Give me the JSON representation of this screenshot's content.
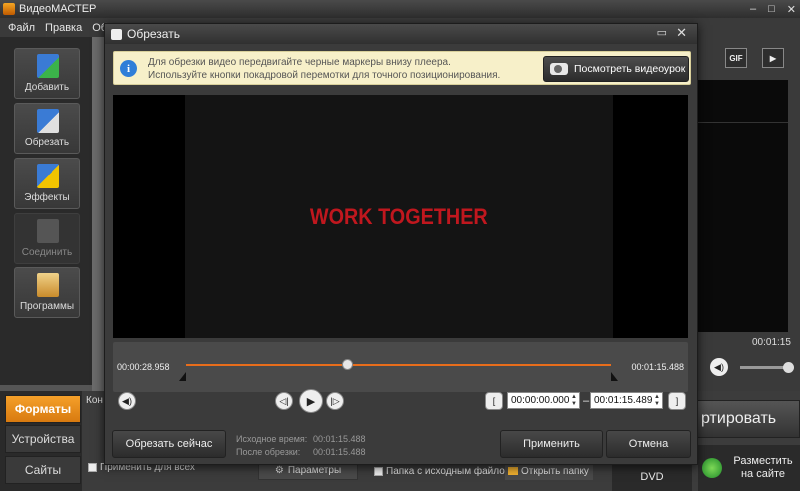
{
  "app": {
    "title": "ВидеоМАСТЕР",
    "window_buttons": [
      "–",
      "□",
      "✕"
    ]
  },
  "menu": [
    "Файл",
    "Правка",
    "Обр"
  ],
  "toolbar": [
    {
      "name": "add",
      "label": "Добавить",
      "icon": "film-plus-icon",
      "color": "#3a9a3a",
      "enabled": true
    },
    {
      "name": "trim",
      "label": "Обрезать",
      "icon": "film-scissors-icon",
      "color": "#3a6fd0",
      "enabled": true
    },
    {
      "name": "effects",
      "label": "Эффекты",
      "icon": "film-star-icon",
      "color": "#d9a400",
      "enabled": true
    },
    {
      "name": "join",
      "label": "Соединить",
      "icon": "film-join-icon",
      "color": "#6a6a6a",
      "enabled": false
    },
    {
      "name": "programs",
      "label": "Программы",
      "icon": "box-icon",
      "color": "#c98b2b",
      "enabled": true
    }
  ],
  "side_tabs": [
    {
      "label": "Форматы",
      "active": true
    },
    {
      "label": "Устройства",
      "active": false
    },
    {
      "label": "Сайты",
      "active": false
    }
  ],
  "background": {
    "right_time": "00:01:15",
    "gif_label": "GIF",
    "convert_label": "ртировать",
    "dvd_label": "DVD",
    "publish_label": "Разместить на сайте",
    "apply_all": "Применить для всех",
    "params": "Параметры",
    "folder_source": "Папка с исходным файлом",
    "open_folder": "Открыть папку",
    "partial_left": "Кон"
  },
  "dialog": {
    "title": "Обрезать",
    "info": {
      "line1": "Для обрезки видео передвигайте черные маркеры внизу плеера.",
      "line2": "Используйте кнопки покадровой перемотки для точного позиционирования.",
      "watch_button": "Посмотреть видеоурок"
    },
    "video_text": "WORK TOGETHER",
    "timeline": {
      "current": "00:00:28.958",
      "end": "00:01:15.488",
      "position": 0.38
    },
    "range": {
      "start": "00:00:00.000",
      "end": "00:01:15.489",
      "separator": "–"
    },
    "buttons": {
      "trim_now": "Обрезать сейчас",
      "apply": "Применить",
      "cancel": "Отмена"
    },
    "durations": {
      "source_label": "Исходное время:",
      "source_value": "00:01:15.488",
      "after_label": "После обрезки:",
      "after_value": "00:01:15.488"
    }
  }
}
